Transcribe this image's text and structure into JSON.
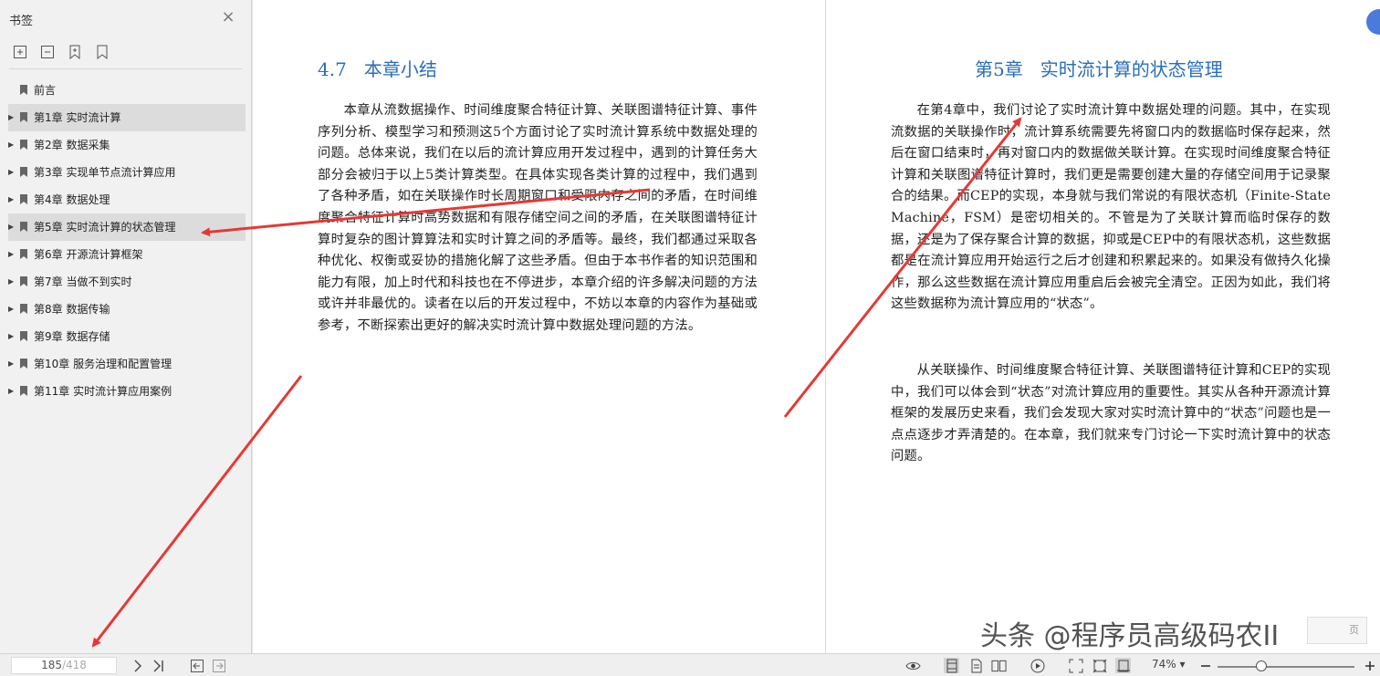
{
  "sidebar": {
    "title": "书签",
    "bookmarks": [
      {
        "label": "前言",
        "expandable": false,
        "selected": false
      },
      {
        "label": "第1章 实时流计算",
        "expandable": true,
        "selected": true
      },
      {
        "label": "第2章 数据采集",
        "expandable": true,
        "selected": false
      },
      {
        "label": "第3章 实现单节点流计算应用",
        "expandable": true,
        "selected": false
      },
      {
        "label": "第4章 数据处理",
        "expandable": true,
        "selected": false
      },
      {
        "label": "第5章 实时流计算的状态管理",
        "expandable": true,
        "selected": true
      },
      {
        "label": "第6章 开源流计算框架",
        "expandable": true,
        "selected": false
      },
      {
        "label": "第7章 当做不到实时",
        "expandable": true,
        "selected": false
      },
      {
        "label": "第8章 数据传输",
        "expandable": true,
        "selected": false
      },
      {
        "label": "第9章 数据存储",
        "expandable": true,
        "selected": false
      },
      {
        "label": "第10章 服务治理和配置管理",
        "expandable": true,
        "selected": false
      },
      {
        "label": "第11章 实时流计算应用案例",
        "expandable": true,
        "selected": false
      }
    ]
  },
  "left_page": {
    "section_title": "4.7   本章小结",
    "paragraph": "本章从流数据操作、时间维度聚合特征计算、关联图谱特征计算、事件序列分析、模型学习和预测这5个方面讨论了实时流计算系统中数据处理的问题。总体来说，我们在以后的流计算应用开发过程中，遇到的计算任务大部分会被归于以上5类计算类型。在具体实现各类计算的过程中，我们遇到了各种矛盾，如在关联操作时长周期窗口和受限内存之间的矛盾，在时间维度聚合特征计算时高势数据和有限存储空间之间的矛盾，在关联图谱特征计算时复杂的图计算算法和实时计算之间的矛盾等。最终，我们都通过采取各种优化、权衡或妥协的措施化解了这些矛盾。但由于本书作者的知识范围和能力有限，加上时代和科技也在不停进步，本章介绍的许多解决问题的方法或许并非最优的。读者在以后的开发过程中，不妨以本章的内容作为基础或参考，不断探索出更好的解决实时流计算中数据处理问题的方法。"
  },
  "right_page": {
    "chapter_title": "第5章   实时流计算的状态管理",
    "paragraph1": "在第4章中，我们讨论了实时流计算中数据处理的问题。其中，在实现流数据的关联操作时，流计算系统需要先将窗口内的数据临时保存起来，然后在窗口结束时，再对窗口内的数据做关联计算。在实现时间维度聚合特征计算和关联图谱特征计算时，我们更是需要创建大量的存储空间用于记录聚合的结果。而CEP的实现，本身就与我们常说的有限状态机（Finite-State Machine，FSM）是密切相关的。不管是为了关联计算而临时保存的数据，还是为了保存聚合计算的数据，抑或是CEP中的有限状态机，这些数据都是在流计算应用开始运行之后才创建和积累起来的。如果没有做持久化操作，那么这些数据在流计算应用重启后会被完全清空。正因为如此，我们将这些数据称为流计算应用的“状态”。",
    "paragraph2": "从关联操作、时间维度聚合特征计算、关联图谱特征计算和CEP的实现中，我们可以体会到“状态”对流计算应用的重要性。其实从各种开源流计算框架的发展历史来看，我们会发现大家对实时流计算中的“状态”问题也是一点点逐步才弄清楚的。在本章，我们就来专门讨论一下实时流计算中的状态问题。"
  },
  "watermark": "头条 @程序员高级码农II",
  "mini_button": "页",
  "statusbar": {
    "current_page": "185",
    "total_pages": "/418",
    "zoom": "74%",
    "zoom_fraction": 0.32
  },
  "colors": {
    "heading": "#2a6fb5",
    "arrow": "#e53935",
    "selected_row": "#dcdcdc"
  }
}
